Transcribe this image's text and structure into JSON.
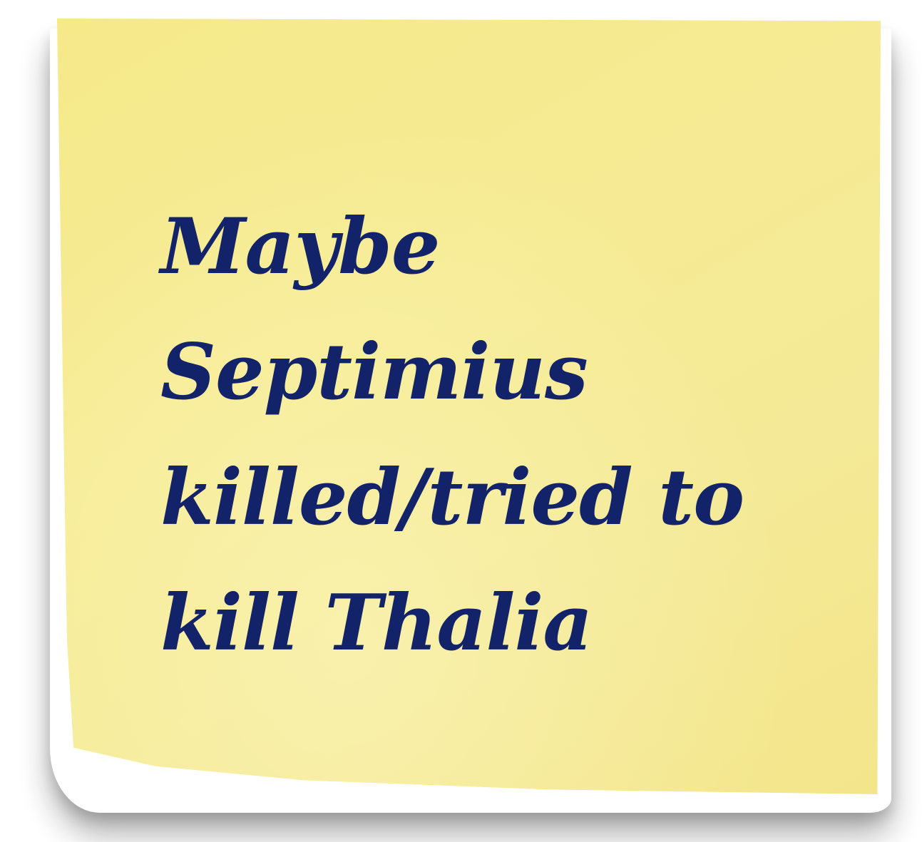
{
  "note": {
    "lines": [
      "Maybe",
      "Septimius",
      "killed/tried to",
      "kill Thalia"
    ]
  },
  "colors": {
    "paper": "#f5e98a",
    "ink": "#12236a"
  }
}
